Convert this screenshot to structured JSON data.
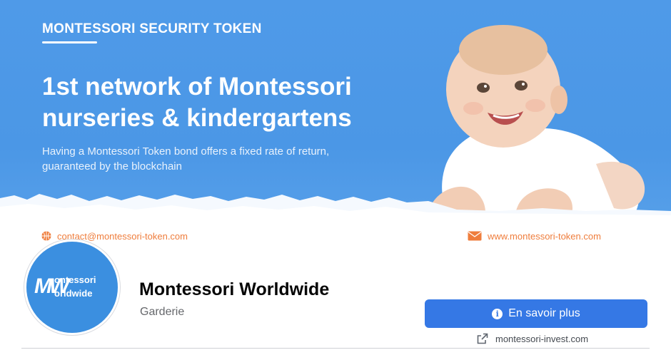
{
  "cover": {
    "kicker": "MONTESSORI SECURITY TOKEN",
    "headline_line1": "1st network of Montessori",
    "headline_line2": "nurseries & kindergartens",
    "subtitle": "Having a Montessori Token bond offers a fixed rate of return, guaranteed by the blockchain",
    "email": "contact@montessori-token.com",
    "website": "www.montessori-token.com",
    "icons": {
      "email": "globe-icon",
      "website": "envelope-icon"
    },
    "colors": {
      "background": "#4b97e6",
      "accent": "#ef7d3c"
    }
  },
  "profile": {
    "avatar": {
      "line1": "ontessori",
      "line2": "orldwide",
      "mark": "MW"
    },
    "name": "Montessori Worldwide",
    "category": "Garderie"
  },
  "actions": {
    "cta_label": "En savoir plus",
    "cta_icon": "info-icon",
    "website_label": "montessori-invest.com",
    "website_icon": "external-link-icon",
    "colors": {
      "button": "#3578e5"
    }
  }
}
